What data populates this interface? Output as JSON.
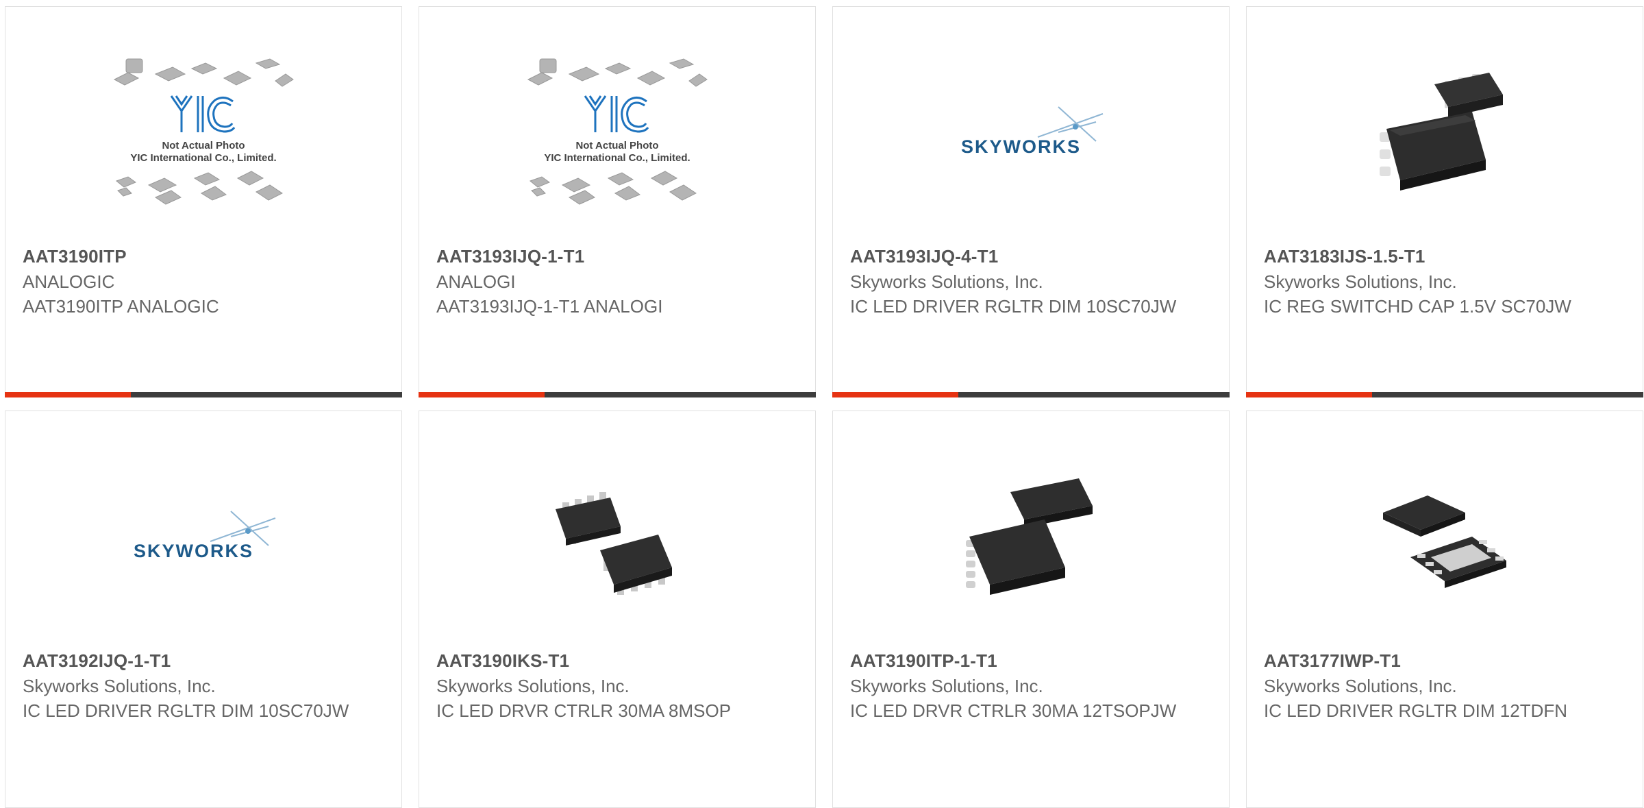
{
  "accent_color": "#e63312",
  "bar_color": "#3d3d3d",
  "products": [
    {
      "part": "AAT3190ITP",
      "manufacturer": "ANALOGIC",
      "description": "AAT3190ITP ANALOGIC",
      "image": "yic-placeholder-icon",
      "photo_note_line1": "Not Actual Photo",
      "photo_note_line2": "YIC International Co., Limited."
    },
    {
      "part": "AAT3193IJQ-1-T1",
      "manufacturer": "ANALOGI",
      "description": "AAT3193IJQ-1-T1 ANALOGI",
      "image": "yic-placeholder-icon",
      "photo_note_line1": "Not Actual Photo",
      "photo_note_line2": "YIC International Co., Limited."
    },
    {
      "part": "AAT3193IJQ-4-T1",
      "manufacturer": "Skyworks Solutions, Inc.",
      "description": "IC LED DRIVER RGLTR DIM 10SC70JW",
      "image": "skyworks-logo",
      "logo_text": "SKYWORKS"
    },
    {
      "part": "AAT3183IJS-1.5-T1",
      "manufacturer": "Skyworks Solutions, Inc.",
      "description": "IC REG SWITCHD CAP 1.5V SC70JW",
      "image": "sc70-chip-icon"
    },
    {
      "part": "AAT3192IJQ-1-T1",
      "manufacturer": "Skyworks Solutions, Inc.",
      "description": "IC LED DRIVER RGLTR DIM 10SC70JW",
      "image": "skyworks-logo",
      "logo_text": "SKYWORKS"
    },
    {
      "part": "AAT3190IKS-T1",
      "manufacturer": "Skyworks Solutions, Inc.",
      "description": "IC LED DRVR CTRLR 30MA 8MSOP",
      "image": "msop-chip-icon"
    },
    {
      "part": "AAT3190ITP-1-T1",
      "manufacturer": "Skyworks Solutions, Inc.",
      "description": "IC LED DRVR CTRLR 30MA 12TSOPJW",
      "image": "tsop-chip-icon"
    },
    {
      "part": "AAT3177IWP-T1",
      "manufacturer": "Skyworks Solutions, Inc.",
      "description": "IC LED DRIVER RGLTR DIM 12TDFN",
      "image": "tdfn-chip-icon"
    }
  ]
}
